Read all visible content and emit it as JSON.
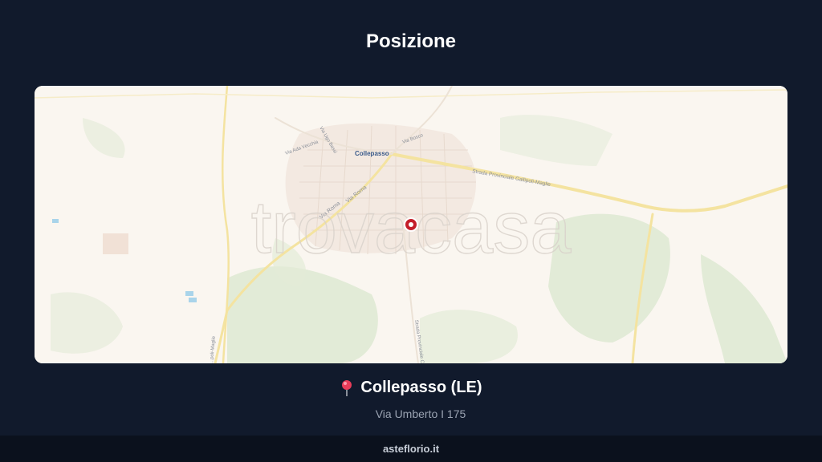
{
  "page": {
    "title": "Posizione"
  },
  "map": {
    "place_labels": {
      "town": "Collepasso",
      "via_roma_1": "Via Roma",
      "via_roma_2": "Via Roma",
      "via_ada_vecchia": "Via Ada Vecchia",
      "via_ugo_bassi": "Via Ugo Bassi",
      "via_bosco": "Via Bosco",
      "strada_provinciale": "Strada Provinciale Gallipoli-Maglie",
      "strada_provinciale_south": "Strada Provinciale C",
      "road_west": "...poli-Maglie"
    },
    "watermark": "trovacasa",
    "marker_icon": "map-pin-icon"
  },
  "location": {
    "icon": "pin-icon",
    "title": "Collepasso (LE)",
    "address": "Via Umberto I 175"
  },
  "footer": {
    "brand": "asteflorio.it"
  },
  "colors": {
    "background": "#111a2c",
    "footer_bg": "#0b111d",
    "map_land": "#faf6f0",
    "map_green": "#dbe9d0",
    "road": "#f7e7a8",
    "marker": "#c41e2a"
  }
}
